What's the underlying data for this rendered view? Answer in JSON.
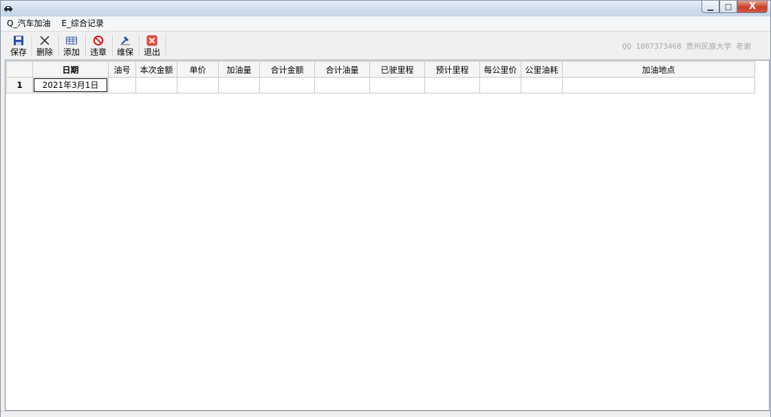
{
  "window": {
    "icon": "car-icon",
    "controls": {
      "minimize": "▁",
      "maximize": "□",
      "close": "X"
    }
  },
  "menu": [
    {
      "label": "Q_汽车加油"
    },
    {
      "label": "E_综合记录"
    }
  ],
  "toolbar": {
    "buttons": [
      {
        "label": "保存",
        "icon": "save-icon"
      },
      {
        "label": "删除",
        "icon": "delete-icon"
      },
      {
        "label": "添加",
        "icon": "add-icon"
      },
      {
        "label": "违章",
        "icon": "violation-icon"
      },
      {
        "label": "维保",
        "icon": "maintenance-icon"
      },
      {
        "label": "退出",
        "icon": "exit-icon"
      }
    ],
    "watermark": "QQ 1007373468 贵州民族大学 老谢"
  },
  "grid": {
    "columns": [
      "日期",
      "油号",
      "本次金额",
      "单价",
      "加油量",
      "合计金额",
      "合计油量",
      "已驶里程",
      "预计里程",
      "每公里价",
      "公里油耗",
      "加油地点"
    ],
    "rows": [
      {
        "index": "1",
        "cells": [
          "2021年3月1日",
          "",
          "",
          "",
          "",
          "",
          "",
          "",
          "",
          "",
          "",
          ""
        ]
      }
    ]
  }
}
